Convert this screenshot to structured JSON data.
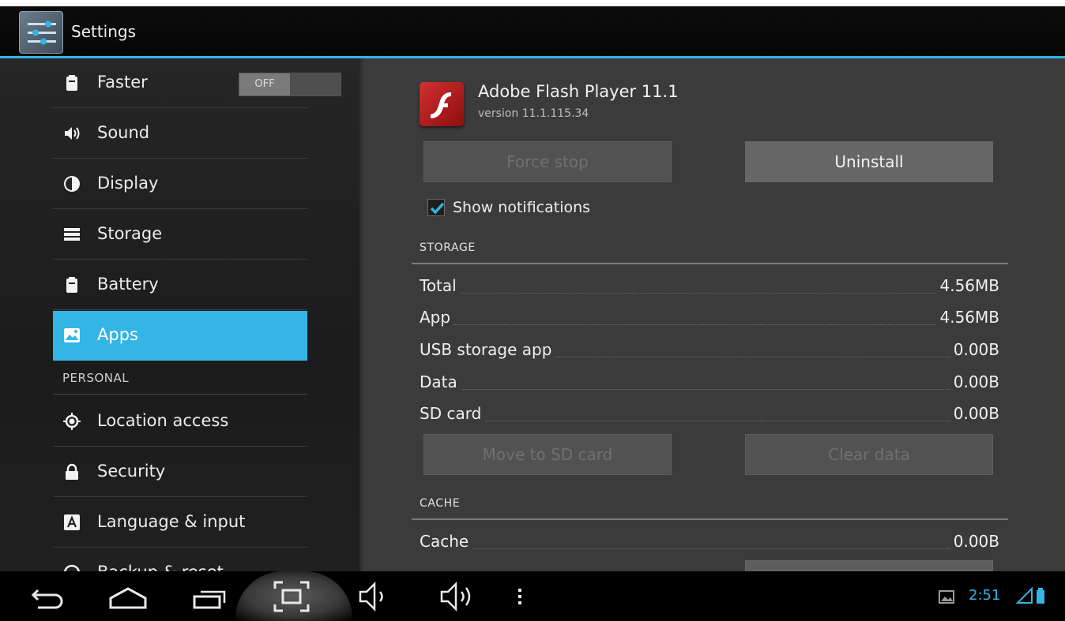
{
  "action_bar": {
    "title": "Settings",
    "accent_color": "#33b5e5"
  },
  "sidebar": {
    "faster": {
      "label": "Faster",
      "toggle_label": "OFF",
      "icon": "lock-icon"
    },
    "items": [
      {
        "label": "Sound",
        "icon": "speaker-icon"
      },
      {
        "label": "Display",
        "icon": "brightness-icon"
      },
      {
        "label": "Storage",
        "icon": "storage-icon"
      },
      {
        "label": "Battery",
        "icon": "battery-icon"
      },
      {
        "label": "Apps",
        "icon": "apps-icon",
        "active": true
      }
    ],
    "section_personal": "PERSONAL",
    "personal_items": [
      {
        "label": "Location access",
        "icon": "location-icon"
      },
      {
        "label": "Security",
        "icon": "padlock-icon"
      },
      {
        "label": "Language & input",
        "icon": "keyboard-a-icon"
      }
    ],
    "partial_item": {
      "label": "Backup & reset",
      "icon": "backup-icon"
    }
  },
  "app_info": {
    "name": "Adobe Flash Player 11.1",
    "version": "version 11.1.115.34",
    "icon": "flash-icon",
    "force_stop_label": "Force stop",
    "uninstall_label": "Uninstall",
    "show_notifications_label": "Show notifications",
    "show_notifications_checked": true,
    "storage_header": "STORAGE",
    "storage_rows": [
      {
        "label": "Total",
        "value": "4.56MB"
      },
      {
        "label": "App",
        "value": "4.56MB"
      },
      {
        "label": "USB storage app",
        "value": "0.00B"
      },
      {
        "label": "Data",
        "value": "0.00B"
      },
      {
        "label": "SD card",
        "value": "0.00B"
      }
    ],
    "move_to_sd_label": "Move to SD card",
    "clear_data_label": "Clear data",
    "cache_header": "CACHE",
    "cache_rows": [
      {
        "label": "Cache",
        "value": "0.00B"
      }
    ]
  },
  "navbar": {
    "time": "2:51",
    "icons": [
      "back-icon",
      "home-icon",
      "recents-icon",
      "screenshot-icon",
      "volume-down-icon",
      "volume-up-icon",
      "menu-dots-icon",
      "gallery-notification-icon",
      "signal-icon",
      "battery-status-icon"
    ]
  }
}
